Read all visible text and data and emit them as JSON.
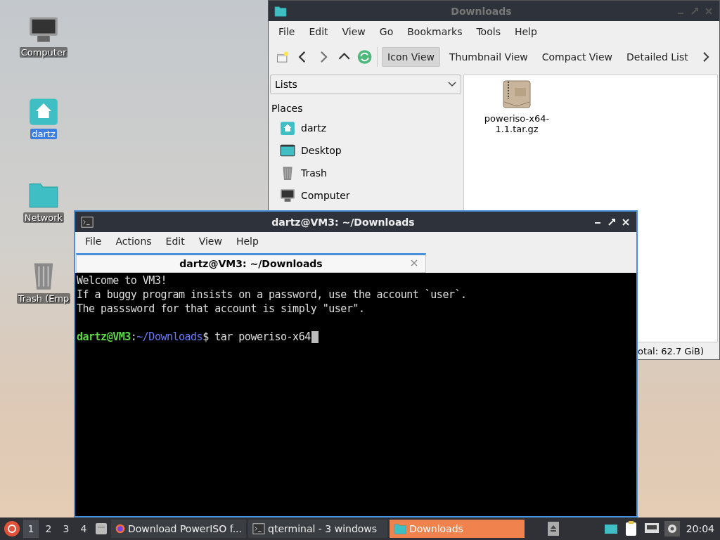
{
  "desktop_icons": [
    {
      "label": "Computer",
      "kind": "computer",
      "selected": false
    },
    {
      "label": "dartz",
      "kind": "home",
      "selected": true
    },
    {
      "label": "Network",
      "kind": "folder",
      "selected": false
    },
    {
      "label": "Trash (Emp",
      "kind": "trash",
      "selected": false
    }
  ],
  "file_manager": {
    "title": "Downloads",
    "menu": [
      "File",
      "Edit",
      "View",
      "Go",
      "Bookmarks",
      "Tools",
      "Help"
    ],
    "views": [
      {
        "label": "Icon View",
        "selected": true
      },
      {
        "label": "Thumbnail View",
        "selected": false
      },
      {
        "label": "Compact View",
        "selected": false
      },
      {
        "label": "Detailed List",
        "selected": false
      }
    ],
    "side_mode": "Lists",
    "places_heading": "Places",
    "places": [
      {
        "label": "dartz",
        "kind": "home"
      },
      {
        "label": "Desktop",
        "kind": "desktop"
      },
      {
        "label": "Trash",
        "kind": "trash"
      },
      {
        "label": "Computer",
        "kind": "computer"
      }
    ],
    "files": [
      {
        "name": "poweriso-x64-1.1.tar.gz",
        "kind": "archive"
      }
    ],
    "status": "otal: 62.7 GiB)"
  },
  "terminal": {
    "title": "dartz@VM3: ~/Downloads",
    "menu": [
      "File",
      "Actions",
      "Edit",
      "View",
      "Help"
    ],
    "tabs": [
      {
        "label": "dartz@VM3: ~/Downloads",
        "selected": true
      }
    ],
    "lines": [
      "Welcome to VM3!",
      "If a buggy program insists on a password, use the account `user`.",
      "The passsword for that account is simply \"user\"."
    ],
    "prompt": {
      "user": "dartz@VM3",
      "separator": ":",
      "path": "~/Downloads",
      "command": "$ tar poweriso-x64"
    }
  },
  "taskbar": {
    "workspaces": [
      {
        "label": "1",
        "selected": true
      },
      {
        "label": "2",
        "selected": false
      },
      {
        "label": "3",
        "selected": false
      },
      {
        "label": "4",
        "selected": false
      }
    ],
    "tasks": [
      {
        "label": "Download PowerISO f...",
        "kind": "browser",
        "selected": false
      },
      {
        "label": "qterminal - 3 windows",
        "kind": "terminal",
        "selected": false
      },
      {
        "label": "Downloads",
        "kind": "folder",
        "selected": true
      }
    ],
    "clock": "20:04"
  }
}
